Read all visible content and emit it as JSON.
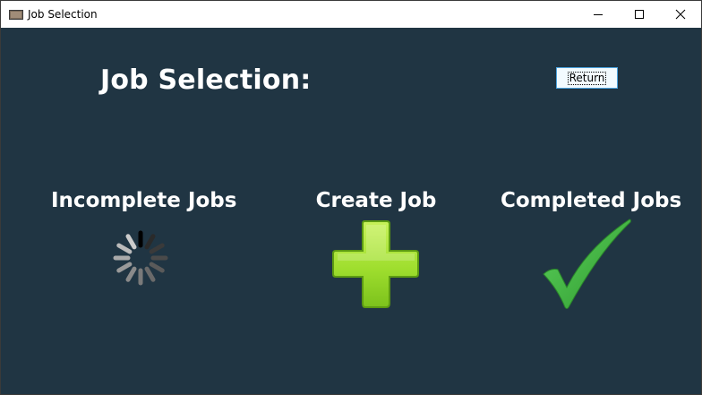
{
  "window": {
    "title": "Job Selection",
    "icon": "folder-icon",
    "controls": [
      "minimize-icon",
      "maximize-icon",
      "close-icon"
    ]
  },
  "page": {
    "title": "Job Selection:",
    "return_label": "Return"
  },
  "options": [
    {
      "label": "Incomplete Jobs",
      "icon": "loading-spinner-icon"
    },
    {
      "label": "Create Job",
      "icon": "plus-icon"
    },
    {
      "label": "Completed Jobs",
      "icon": "checkmark-icon"
    }
  ],
  "colors": {
    "background": "#203543",
    "text": "#ffffff",
    "plus_green": "#a6e23a",
    "check_green": "#3cb43c"
  }
}
